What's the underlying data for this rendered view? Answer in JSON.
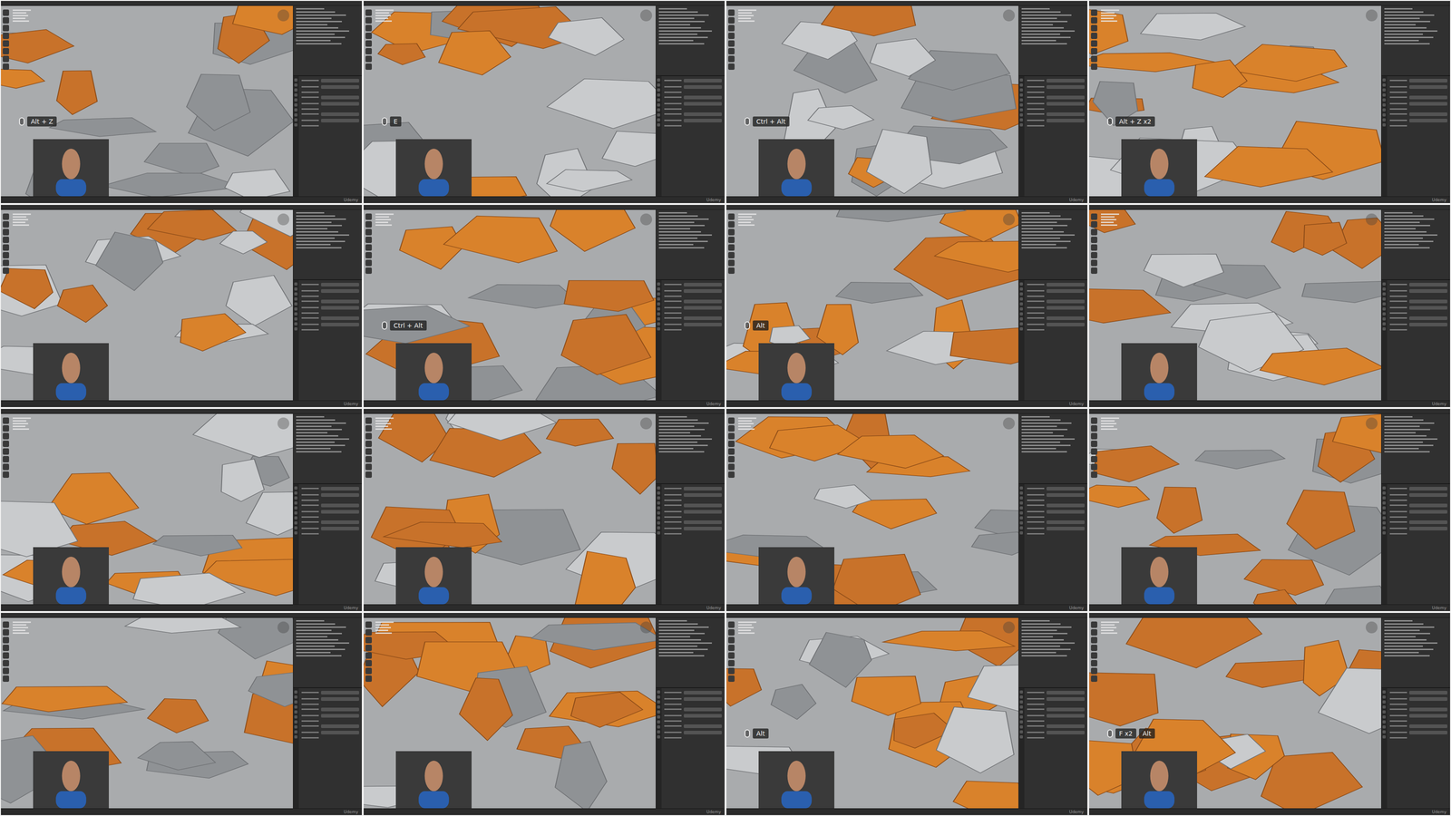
{
  "frames": [
    {
      "keys": [
        "Alt + Z"
      ]
    },
    {
      "keys": [
        "E"
      ]
    },
    {
      "keys": [
        "Ctrl + Alt"
      ]
    },
    {
      "keys": [
        "Alt + Z x2"
      ]
    },
    {
      "keys": []
    },
    {
      "keys": [
        "Ctrl + Alt"
      ]
    },
    {
      "keys": [
        "Alt"
      ]
    },
    {
      "keys": []
    },
    {
      "keys": []
    },
    {
      "keys": []
    },
    {
      "keys": []
    },
    {
      "keys": []
    },
    {
      "keys": []
    },
    {
      "keys": []
    },
    {
      "keys": [
        "Alt"
      ]
    },
    {
      "keys": [
        "F x2",
        "Alt"
      ]
    }
  ],
  "watermark": "Udemy"
}
